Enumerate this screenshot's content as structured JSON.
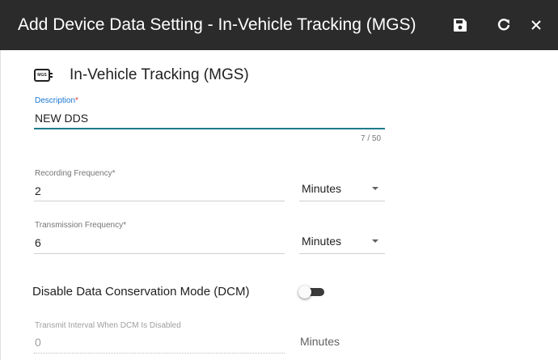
{
  "dialog": {
    "title": "Add Device Data Setting - In-Vehicle Tracking (MGS)",
    "save_icon": "floppy-disk-icon",
    "reset_icon": "refresh-icon",
    "close_icon": "close-icon",
    "header_bg": "#2b2b2b"
  },
  "device": {
    "icon_text": "MGS",
    "name": "In-Vehicle Tracking (MGS)"
  },
  "description": {
    "label": "Description",
    "required_mark": "*",
    "value": "NEW DDS",
    "counter": "7 / 50",
    "accent": "#1f7a8c"
  },
  "recording": {
    "label": "Recording Frequency",
    "required_mark": "*",
    "value": "2",
    "unit": "Minutes"
  },
  "transmission": {
    "label": "Transmission Frequency",
    "required_mark": "*",
    "value": "6",
    "unit": "Minutes"
  },
  "dcm": {
    "label": "Disable Data Conservation Mode (DCM)",
    "enabled": false
  },
  "transmit_interval": {
    "label": "Transmit Interval When DCM Is Disabled",
    "value": "0",
    "unit": "Minutes"
  }
}
